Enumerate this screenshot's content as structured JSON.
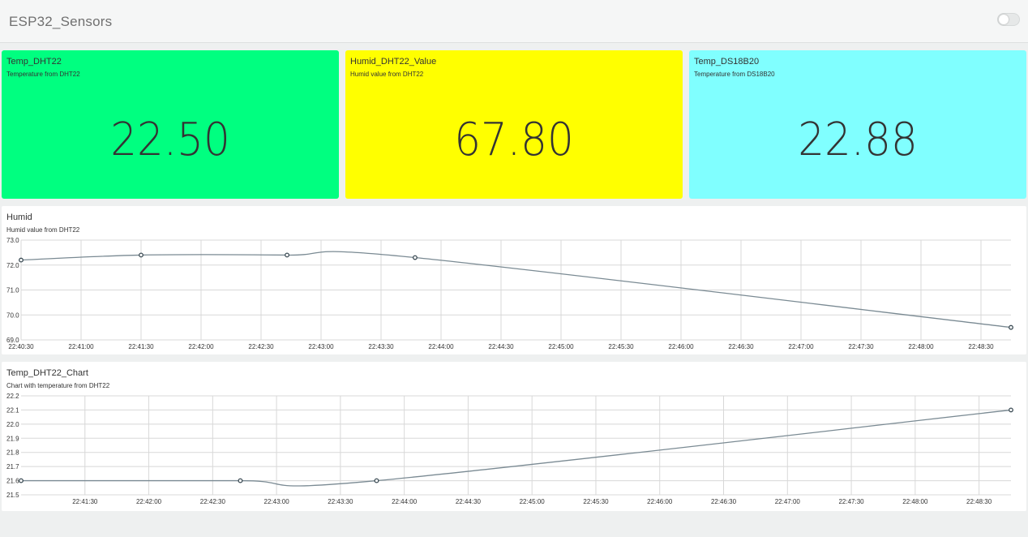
{
  "app": {
    "title": "ESP32_Sensors"
  },
  "cards": [
    {
      "title": "Temp_DHT22",
      "subtitle": "Temperature from DHT22",
      "value": "22.50",
      "color": "#00ff80"
    },
    {
      "title": "Humid_DHT22_Value",
      "subtitle": "Humid value from DHT22",
      "value": "67.80",
      "color": "#ffff00"
    },
    {
      "title": "Temp_DS18B20",
      "subtitle": "Temperature from DS18B20",
      "value": "22.88",
      "color": "#80ffff"
    }
  ],
  "colors": {
    "line": "#7a8a93",
    "point": "#3a4a53",
    "grid": "#d8d8d8",
    "background": "#eef0f0"
  },
  "chart_data": [
    {
      "type": "line",
      "title": "Humid",
      "subtitle": "Humid value from DHT22",
      "x_ticks": [
        "22:40:30",
        "22:41:00",
        "22:41:30",
        "22:42:00",
        "22:42:30",
        "22:43:00",
        "22:43:30",
        "22:44:00",
        "22:44:30",
        "22:45:00",
        "22:45:30",
        "22:46:00",
        "22:46:30",
        "22:47:00",
        "22:47:30",
        "22:48:00",
        "22:48:30"
      ],
      "y_ticks": [
        "69.0",
        "70.0",
        "71.0",
        "72.0",
        "73.0"
      ],
      "xlim": [
        "22:40:30",
        "22:48:45"
      ],
      "ylim": [
        69.0,
        73.0
      ],
      "grid": true,
      "points": [
        {
          "x": "22:40:30",
          "y": 72.2
        },
        {
          "x": "22:41:30",
          "y": 72.4
        },
        {
          "x": "22:42:43",
          "y": 72.4
        },
        {
          "x": "22:43:47",
          "y": 72.3
        },
        {
          "x": "22:48:45",
          "y": 69.5
        }
      ]
    },
    {
      "type": "line",
      "title": "Temp_DHT22_Chart",
      "subtitle": "Chart with temperature from DHT22",
      "x_ticks": [
        "22:41:30",
        "22:42:00",
        "22:42:30",
        "22:43:00",
        "22:43:30",
        "22:44:00",
        "22:44:30",
        "22:45:00",
        "22:45:30",
        "22:46:00",
        "22:46:30",
        "22:47:00",
        "22:47:30",
        "22:48:00",
        "22:48:30"
      ],
      "y_ticks": [
        "21.5",
        "21.6",
        "21.7",
        "21.8",
        "21.9",
        "22.0",
        "22.1",
        "22.2"
      ],
      "xlim": [
        "22:41:00",
        "22:48:45"
      ],
      "ylim": [
        21.5,
        22.2
      ],
      "grid": true,
      "points": [
        {
          "x": "22:41:00",
          "y": 21.6
        },
        {
          "x": "22:42:43",
          "y": 21.6
        },
        {
          "x": "22:43:47",
          "y": 21.6
        },
        {
          "x": "22:48:45",
          "y": 22.1
        }
      ]
    }
  ]
}
